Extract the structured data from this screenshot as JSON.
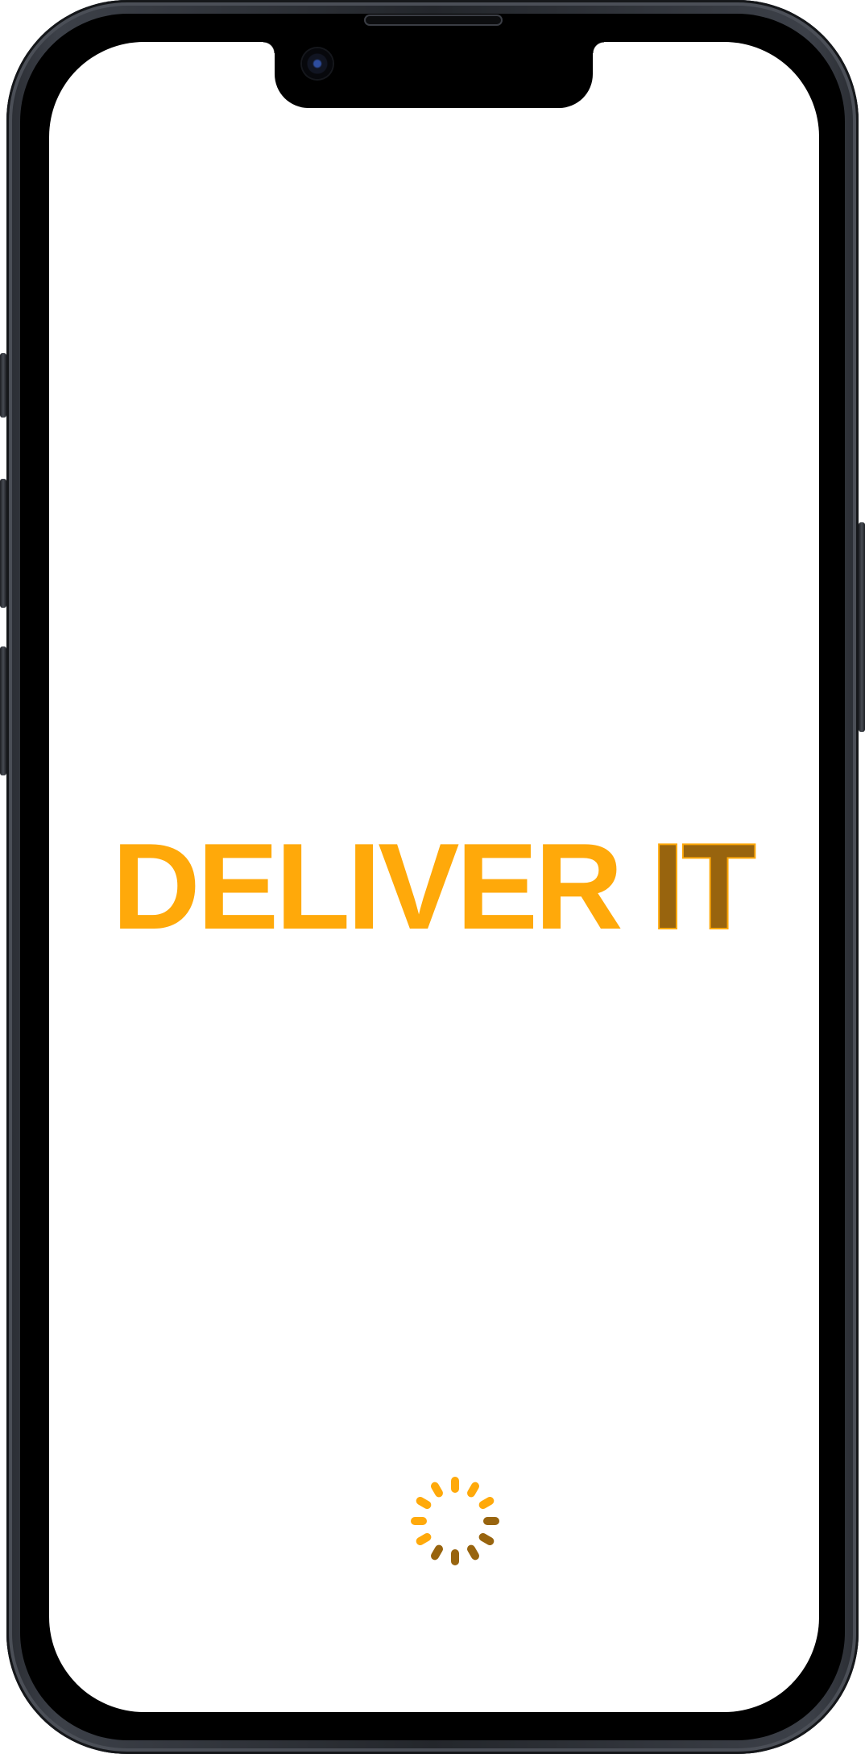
{
  "app": {
    "logo_text_primary": "DELIVER",
    "logo_text_secondary": "IT"
  },
  "loading": {
    "state": "loading",
    "spinner_colors": {
      "bright": "#ffa90a",
      "dim": "#98640e"
    }
  },
  "colors": {
    "accent": "#ffa90a",
    "accent_dark": "#98640e",
    "background": "#ffffff",
    "frame": "#2a2d33"
  }
}
